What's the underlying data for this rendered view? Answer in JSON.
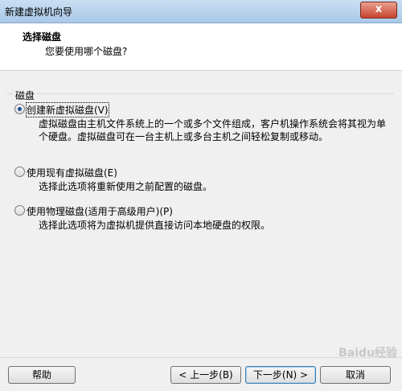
{
  "window": {
    "title": "新建虚拟机向导",
    "close_label": "x"
  },
  "header": {
    "title": "选择磁盘",
    "subtitle": "您要使用哪个磁盘?"
  },
  "group": {
    "label": "磁盘"
  },
  "options": [
    {
      "label": "创建新虚拟磁盘(V)",
      "description": "虚拟磁盘由主机文件系统上的一个或多个文件组成，客户机操作系统会将其视为单个硬盘。虚拟磁盘可在一台主机上或多台主机之间轻松复制或移动。",
      "selected": true
    },
    {
      "label": "使用现有虚拟磁盘(E)",
      "description": "选择此选项将重新使用之前配置的磁盘。",
      "selected": false
    },
    {
      "label": "使用物理磁盘(适用于高级用户)(P)",
      "description": "选择此选项将为虚拟机提供直接访问本地硬盘的权限。",
      "selected": false
    }
  ],
  "buttons": {
    "help": "帮助",
    "back": "< 上一步(B)",
    "next": "下一步(N) >",
    "cancel": "取消"
  },
  "watermark": "Baidu经验"
}
